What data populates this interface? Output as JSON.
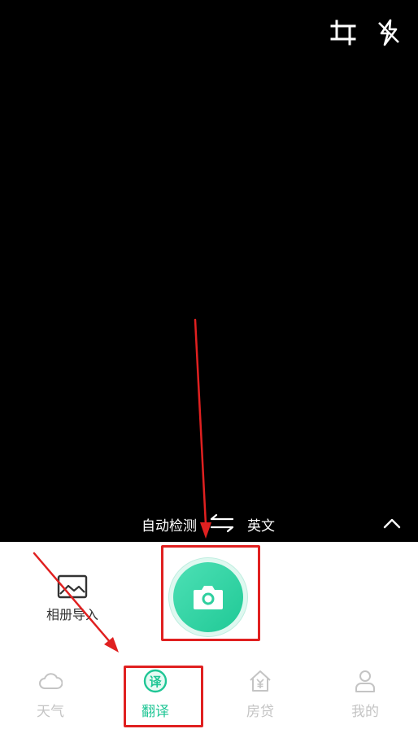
{
  "camera": {
    "crop_icon": "crop-icon",
    "flash_icon": "flash-off-icon"
  },
  "language_bar": {
    "source": "自动检测",
    "target": "英文",
    "swap_icon": "swap-arrows-icon",
    "collapse_icon": "chevron-up-icon"
  },
  "controls": {
    "album_label": "相册导入",
    "album_icon": "image-icon",
    "shutter_icon": "camera-icon"
  },
  "tabs": [
    {
      "label": "天气",
      "icon": "cloud-icon",
      "active": false
    },
    {
      "label": "翻译",
      "icon": "translate-icon",
      "active": true
    },
    {
      "label": "房贷",
      "icon": "house-yuan-icon",
      "active": false
    },
    {
      "label": "我的",
      "icon": "person-icon",
      "active": false
    }
  ],
  "colors": {
    "accent": "#1fc695",
    "inactive": "#c4c4c4",
    "annotation": "#e02020"
  }
}
